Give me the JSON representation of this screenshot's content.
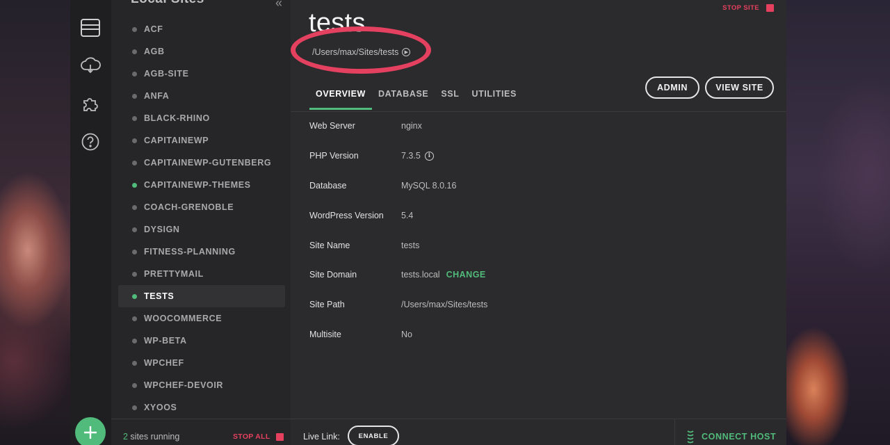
{
  "sidebar": {
    "title": "Local Sites",
    "sites": [
      {
        "name": "ACF",
        "running": false,
        "active": false
      },
      {
        "name": "AGB",
        "running": false,
        "active": false
      },
      {
        "name": "AGB-SITE",
        "running": false,
        "active": false
      },
      {
        "name": "ANFA",
        "running": false,
        "active": false
      },
      {
        "name": "BLACK-RHINO",
        "running": false,
        "active": false
      },
      {
        "name": "CAPITAINEWP",
        "running": false,
        "active": false
      },
      {
        "name": "CAPITAINEWP-GUTENBERG",
        "running": false,
        "active": false
      },
      {
        "name": "CAPITAINEWP-THEMES",
        "running": true,
        "active": false
      },
      {
        "name": "COACH-GRENOBLE",
        "running": false,
        "active": false
      },
      {
        "name": "DYSIGN",
        "running": false,
        "active": false
      },
      {
        "name": "FITNESS-PLANNING",
        "running": false,
        "active": false
      },
      {
        "name": "PRETTYMAIL",
        "running": false,
        "active": false
      },
      {
        "name": "TESTS",
        "running": true,
        "active": true
      },
      {
        "name": "WOOCOMMERCE",
        "running": false,
        "active": false
      },
      {
        "name": "WP-BETA",
        "running": false,
        "active": false
      },
      {
        "name": "WPCHEF",
        "running": false,
        "active": false
      },
      {
        "name": "WPCHEF-DEVOIR",
        "running": false,
        "active": false
      },
      {
        "name": "XYOOS",
        "running": false,
        "active": false
      }
    ],
    "running_count": "2",
    "running_text": " sites running",
    "stop_all_label": "STOP ALL"
  },
  "site": {
    "title": "tests",
    "path": "/Users/max/Sites/tests",
    "stop_site_label": "STOP SITE"
  },
  "tabs": [
    "OVERVIEW",
    "DATABASE",
    "SSL",
    "UTILITIES"
  ],
  "actions": {
    "admin_label": "ADMIN",
    "view_site_label": "VIEW SITE"
  },
  "overview": {
    "rows": [
      {
        "label": "Web Server",
        "value": "nginx"
      },
      {
        "label": "PHP Version",
        "value": "7.3.5"
      },
      {
        "label": "Database",
        "value": "MySQL 8.0.16"
      },
      {
        "label": "WordPress Version",
        "value": "5.4"
      },
      {
        "label": "Site Name",
        "value": "tests"
      },
      {
        "label": "Site Domain",
        "value": "tests.local"
      },
      {
        "label": "Site Path",
        "value": "/Users/max/Sites/tests"
      },
      {
        "label": "Multisite",
        "value": "No"
      }
    ],
    "change_label": "CHANGE"
  },
  "footer": {
    "live_link_label": "Live Link:",
    "enable_label": "ENABLE",
    "connect_host_label": "CONNECT HOST"
  },
  "colors": {
    "accent_green": "#51bb7b",
    "stop_red": "#e5405e",
    "annotation_ring": "#e4405f"
  }
}
